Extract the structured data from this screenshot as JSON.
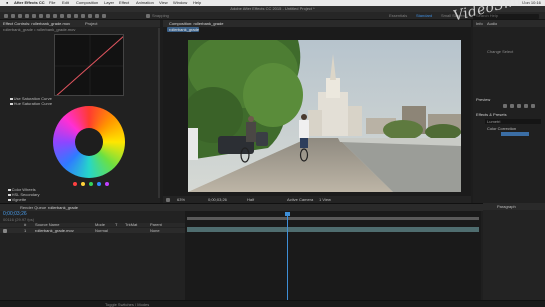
{
  "menubar": {
    "app_name": "After Effects CC",
    "items": [
      "File",
      "Edit",
      "Composition",
      "Layer",
      "Effect",
      "Animation",
      "View",
      "Window",
      "Help"
    ],
    "clock": "Mon 10:16"
  },
  "titlebar": {
    "title": "Adobe After Effects CC 2015 - Untitled Project *"
  },
  "toolbar": {
    "snapping_label": "Snapping",
    "workspaces": [
      "Essentials",
      "Standard",
      "Small Screen"
    ],
    "search_placeholder": "Search Help"
  },
  "left_panel": {
    "tab_effect_controls": "Effect Controls: rollerbank_grade.mov",
    "tab_project": "Project",
    "breadcrumb": "rollerbank_grade • rollerbank_grade.mov",
    "options": [
      "Use Saturation Curve",
      "Hue Saturation Curve"
    ],
    "options_lower": [
      "Color Wheels",
      "HSL Secondary",
      "Vignette"
    ],
    "swatch_colors": [
      "#ff4040",
      "#ffd23a",
      "#36d25a",
      "#2f8bff",
      "#c13fff"
    ]
  },
  "composition": {
    "tab_label": "Composition: rollerbank_grade",
    "sub_tab": "rollerbank_grade",
    "zoom": "63%",
    "timecode": "0;00;03;26",
    "resolution": "Half",
    "camera": "Active Camera",
    "views": "1 View"
  },
  "right_panel": {
    "info_items": [
      "Info",
      "Audio",
      "Preview"
    ],
    "preview_label": "Preview",
    "effects_label": "Effects & Presets",
    "effects_items": [
      "Lumetri",
      "Color Correction"
    ],
    "info_value": "Change Select"
  },
  "watermark": "VideoSmile",
  "timeline": {
    "render_queue_tab": "Render Queue",
    "comp_tab": "rollerbank_grade",
    "timecode": "0;00;03;26",
    "frame_info": "00116 (29.97 fps)",
    "column_headers": [
      "#",
      "Source Name",
      "Mode",
      "T",
      "TrkMat",
      "Parent"
    ],
    "layer": {
      "index": "1",
      "name": "rollerbank_grade.mov",
      "mode": "Normal",
      "parent": "None"
    },
    "paragraph_tab": "Paragraph"
  },
  "statusbar": {
    "toggle_label": "Toggle Switches / Modes"
  }
}
